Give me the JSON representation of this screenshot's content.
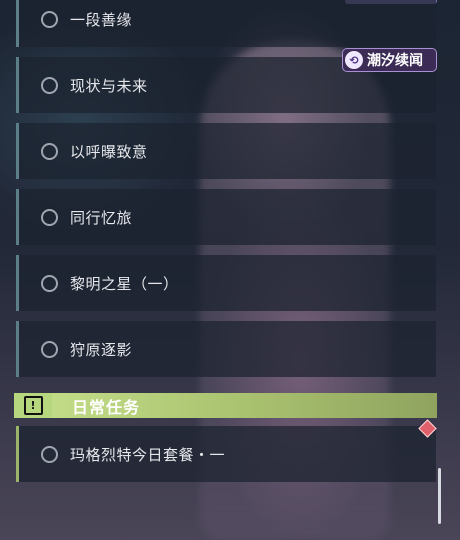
{
  "quests": [
    {
      "label": "一段善缘"
    },
    {
      "label": "现状与未来"
    },
    {
      "label": "以呼曝致意"
    },
    {
      "label": "同行忆旅"
    },
    {
      "label": "黎明之星（一）"
    },
    {
      "label": "狩原逐影"
    }
  ],
  "event_badge": {
    "label": "潮汐续闻",
    "icon": "tide-event-icon"
  },
  "daily_section": {
    "title": "日常任务",
    "icon_glyph": "!",
    "items": [
      {
        "label": "玛格烈特今日套餐・一"
      }
    ]
  },
  "colors": {
    "regular_accent": "#5c7e89",
    "daily_accent": "#9cb36c",
    "badge_border": "#a98fd3",
    "new_marker": "#e0606c"
  }
}
